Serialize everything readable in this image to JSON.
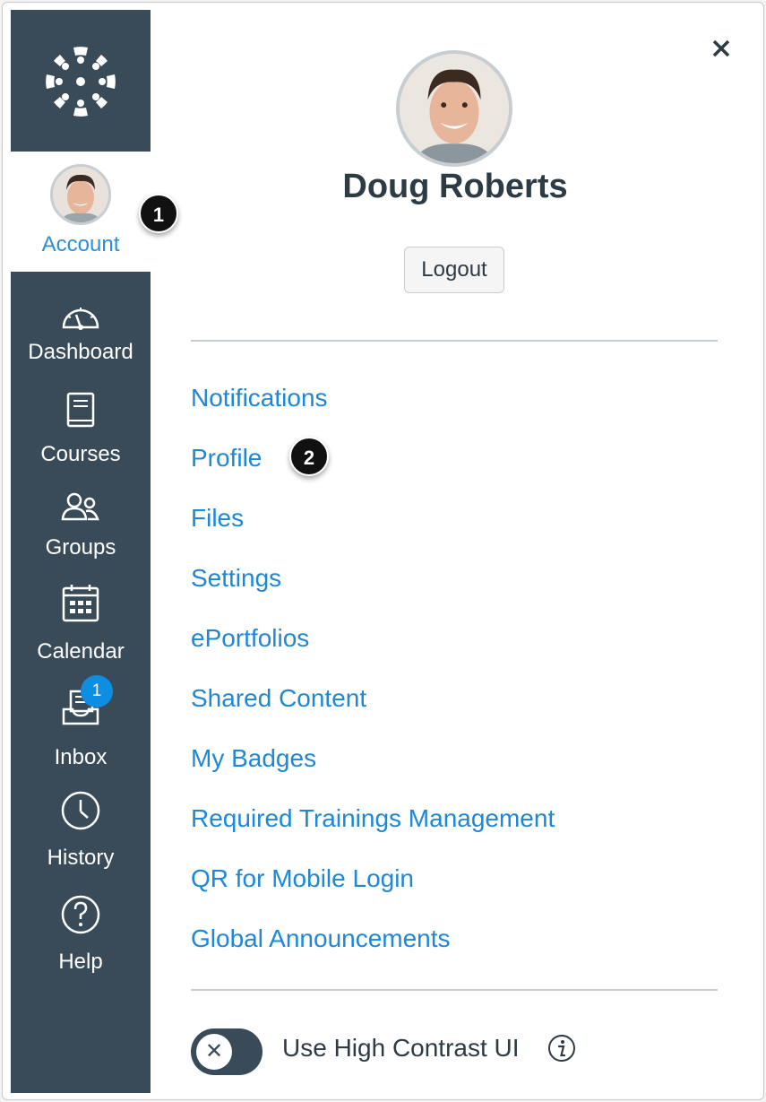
{
  "nav": {
    "account_label": "Account",
    "items": [
      {
        "label": "Dashboard",
        "icon": "dashboard-icon"
      },
      {
        "label": "Courses",
        "icon": "courses-icon"
      },
      {
        "label": "Groups",
        "icon": "groups-icon"
      },
      {
        "label": "Calendar",
        "icon": "calendar-icon"
      },
      {
        "label": "Inbox",
        "icon": "inbox-icon"
      },
      {
        "label": "History",
        "icon": "history-icon"
      },
      {
        "label": "Help",
        "icon": "help-icon"
      }
    ],
    "inbox_badge": "1"
  },
  "callouts": {
    "account": "1",
    "profile": "2"
  },
  "tray": {
    "user_name": "Doug Roberts",
    "logout_label": "Logout",
    "links": [
      "Notifications",
      "Profile",
      "Files",
      "Settings",
      "ePortfolios",
      "Shared Content",
      "My Badges",
      "Required Trainings Management",
      "QR for Mobile Login",
      "Global Announcements"
    ],
    "high_contrast_label": "Use High Contrast UI",
    "high_contrast_on": false
  },
  "colors": {
    "nav_bg": "#394b58",
    "link": "#1e87d6",
    "account_label": "#2d8ed9",
    "badge": "#0e8ee3",
    "text_dark": "#2d3b45"
  }
}
